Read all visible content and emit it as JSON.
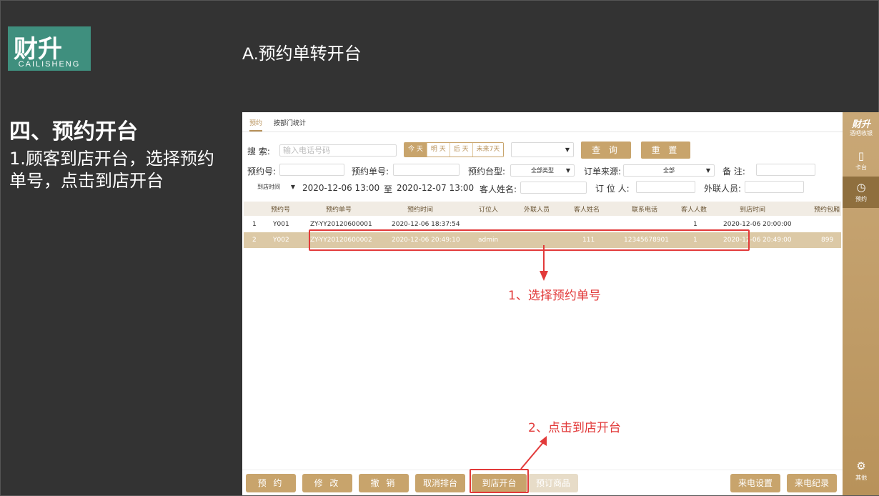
{
  "logo": {
    "brand": "财升",
    "sub": "CAILISHENG"
  },
  "slide_heading": "A.预约单转开台",
  "section_title": "四、预约开台",
  "section_desc": "1.顾客到店开台，选择预约单号，点击到店开台",
  "tabs": [
    "预约",
    "按部门统计"
  ],
  "search": {
    "label": "搜   索:",
    "placeholder": "输入电话号码",
    "quick": [
      "今 天",
      "明 天",
      "后 天",
      "未来7天"
    ],
    "query_button": "查 询",
    "reset_button": "重 置"
  },
  "filters": {
    "booking_no_label": "预约号:",
    "booking_order_label": "预约单号:",
    "table_type_label": "预约台型:",
    "table_type_value": "全部类型",
    "source_label": "订单来源:",
    "source_value": "全部",
    "remark_label": "备   注:",
    "time_type": "到店时间",
    "date_from": "2020-12-06 13:00",
    "to": "至",
    "date_to": "2020-12-07 13:00",
    "guest_name_label": "客人姓名:",
    "booker_label": "订 位 人:",
    "contact_label": "外联人员:"
  },
  "table": {
    "headers": [
      "预约号",
      "预约单号",
      "预约时间",
      "订位人",
      "外联人员",
      "客人姓名",
      "联系电话",
      "客人人数",
      "到店时间",
      "预约包厢"
    ],
    "rows": [
      {
        "idx": "1",
        "no": "Y001",
        "order": "ZY-YY20120600001",
        "time": "2020-12-06 18:37:54",
        "booker": "",
        "contact": "",
        "guest": "",
        "phone": "",
        "count": "1",
        "arrive": "2020-12-06 20:00:00",
        "room": ""
      },
      {
        "idx": "2",
        "no": "Y002",
        "order": "ZY-YY20120600002",
        "time": "2020-12-06 20:49:10",
        "booker": "admin",
        "contact": "",
        "guest": "111",
        "phone": "12345678901",
        "count": "1",
        "arrive": "2020-12-06 20:49:00",
        "room": "899"
      }
    ]
  },
  "annotations": {
    "step1": "1、选择预约单号",
    "step2": "2、点击到店开台"
  },
  "bottom_buttons": [
    "预 约",
    "修 改",
    "撤 销",
    "取消排台",
    "到店开台",
    "预订商品",
    "来电设置",
    "来电纪录"
  ],
  "sidebar": {
    "brand": "财升",
    "brand_sub": "酒吧收银",
    "items": [
      "卡台",
      "预约"
    ],
    "other": "其他"
  },
  "colors": {
    "accent": "#c8a46c",
    "annotation": "#e23a3a",
    "selected_row": "#dcc9a6"
  }
}
